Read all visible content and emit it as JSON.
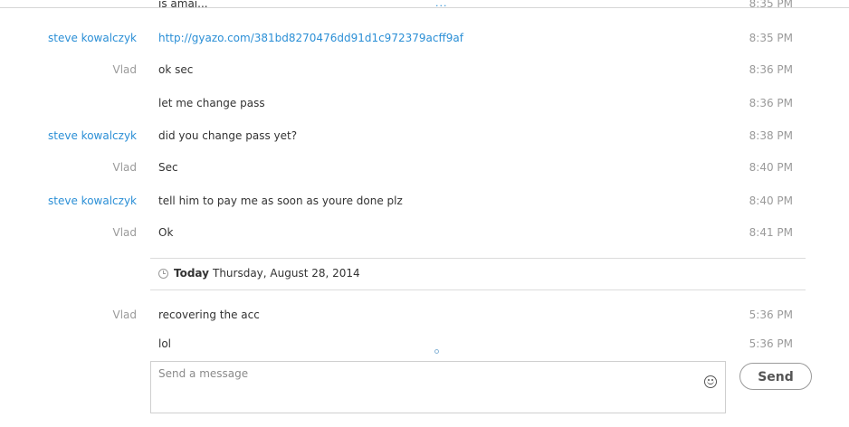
{
  "top_indicator": "...",
  "partial_top": {
    "text": "is amai...",
    "time": "8:35 PM"
  },
  "messages": [
    {
      "sender": "steve kowalczyk",
      "text": "http://gyazo.com/381bd8270476dd91d1c972379acff9af",
      "time": "8:35 PM"
    },
    {
      "sender": "Vlad",
      "text": "ok sec",
      "time": "8:36 PM"
    },
    {
      "sender": "",
      "text": "let me change pass",
      "time": "8:36 PM"
    },
    {
      "sender": "steve kowalczyk",
      "text": "did you change pass yet?",
      "time": "8:38 PM"
    },
    {
      "sender": "Vlad",
      "text": "Sec",
      "time": "8:40 PM"
    },
    {
      "sender": "steve kowalczyk",
      "text": "tell him to pay me as soon as youre done plz",
      "time": "8:40 PM"
    },
    {
      "sender": "Vlad",
      "text": "Ok",
      "time": "8:41 PM"
    }
  ],
  "date_separator": {
    "icon": "clock-icon",
    "today_label": "Today",
    "date": "Thursday, August 28, 2014"
  },
  "messages_today": [
    {
      "sender": "Vlad",
      "text": "recovering the acc",
      "time": "5:36 PM"
    },
    {
      "sender": "",
      "text": "lol",
      "time": "5:36 PM"
    }
  ],
  "composer": {
    "placeholder": "Send a message",
    "emoji_icon": "smiley-icon",
    "send_label": "Send"
  },
  "colors": {
    "self_sender": "#2b8fd6",
    "other_sender": "#9a9a9a",
    "link": "#2b8fd6",
    "timestamp": "#9a9a9a"
  }
}
